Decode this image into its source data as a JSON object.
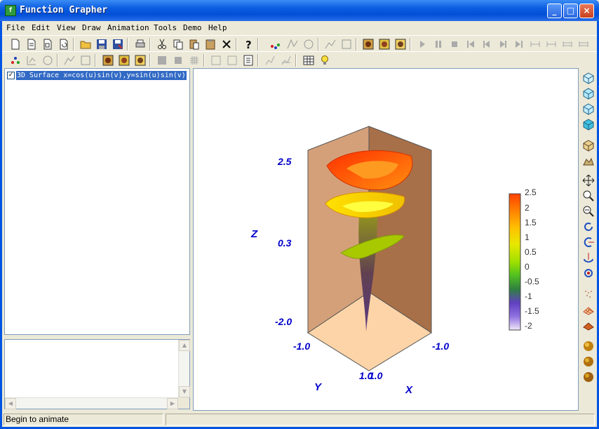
{
  "window": {
    "title": "Function Grapher",
    "icon": "graph-app-icon",
    "controls": [
      "minimize",
      "maximize",
      "close"
    ]
  },
  "menu": [
    "File",
    "Edit",
    "View",
    "Draw",
    "Animation",
    "Tools",
    "Demo",
    "Help"
  ],
  "tree": {
    "items": [
      {
        "checked": true,
        "label": "3D Surface  x=cos(u)sin(v),y=sin(u)sin(v)"
      }
    ]
  },
  "plot": {
    "axes": {
      "z_label": "Z",
      "y_label": "Y",
      "x_label": "X",
      "z_ticks": [
        "2.5",
        "0.3",
        "-2.0"
      ],
      "y_ticks": [
        "-1.0",
        "1.0"
      ],
      "x_ticks": [
        "1.0",
        "-1.0"
      ]
    },
    "colorbar": {
      "ticks": [
        "2.5",
        "2",
        "1.5",
        "1",
        "0.5",
        "0",
        "-0.5",
        "-1",
        "-1.5",
        "-2"
      ],
      "colors": [
        "#ff4000",
        "#ff8000",
        "#ffc000",
        "#e8e800",
        "#a0e000",
        "#50c020",
        "#308040",
        "#6040c0",
        "#9070e0",
        "#e8d8f8"
      ]
    }
  },
  "status": {
    "text": "Begin to animate"
  }
}
